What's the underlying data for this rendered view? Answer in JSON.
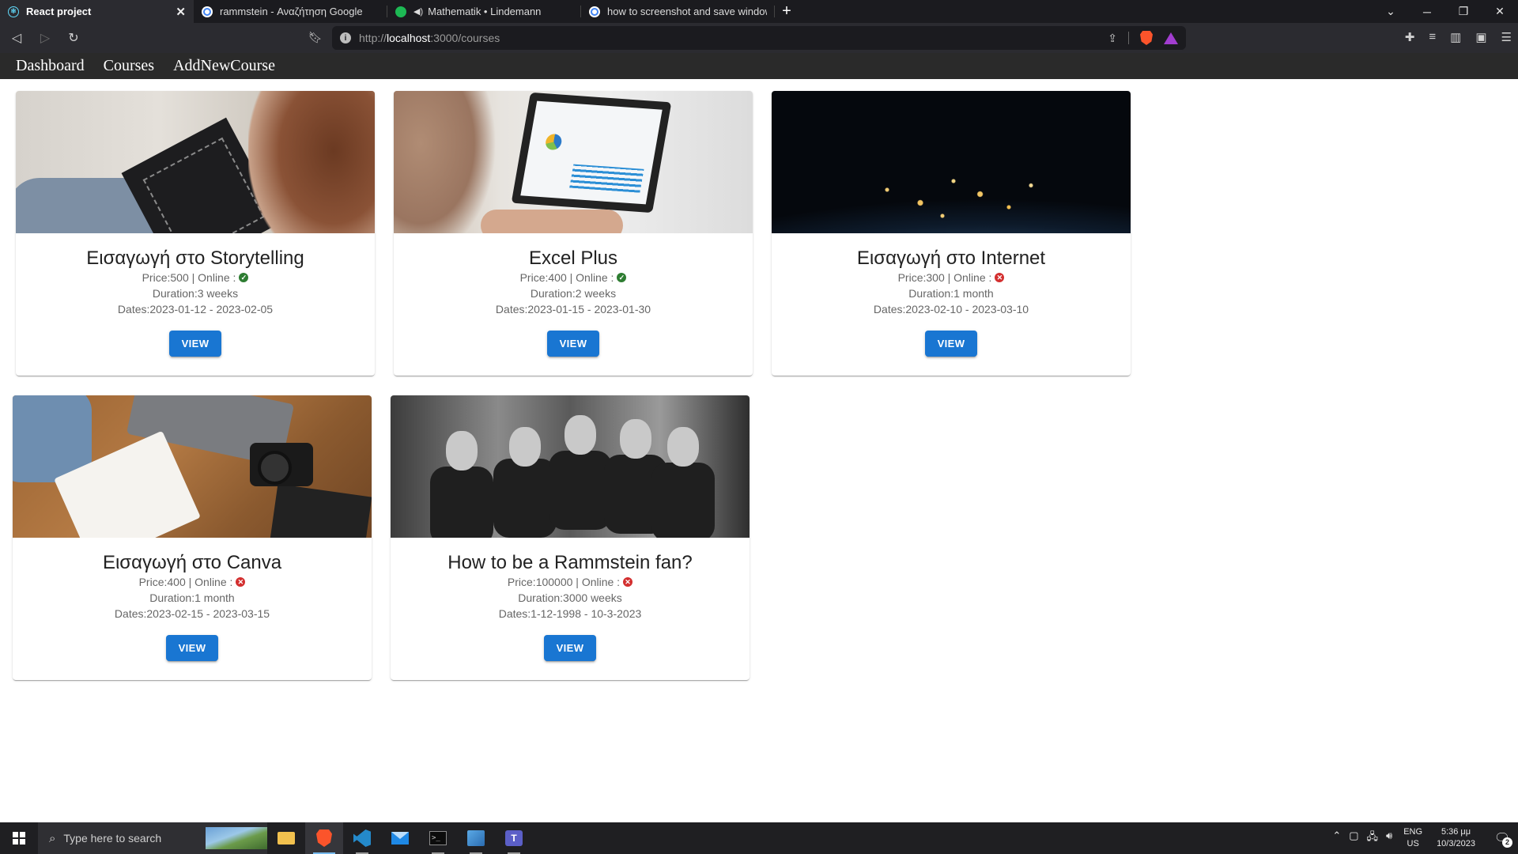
{
  "browser": {
    "tabs": [
      {
        "title": "React project",
        "favicon": "react-icon",
        "active": true
      },
      {
        "title": "rammstein - Αναζήτηση Google",
        "favicon": "google-icon",
        "active": false
      },
      {
        "title": "Mathematik • Lindemann",
        "favicon": "spotify-icon",
        "active": false,
        "audio": true
      },
      {
        "title": "how to screenshot and save windows",
        "favicon": "google-icon",
        "active": false
      }
    ],
    "url_prefix": "http://",
    "url_host": "localhost",
    "url_path": ":3000/courses"
  },
  "nav": {
    "links": [
      "Dashboard",
      "Courses",
      "AddNewCourse"
    ]
  },
  "courses": [
    {
      "title": "Εισαγωγή στο Storytelling",
      "price_text": "Price:500 | Online :",
      "online": true,
      "duration_text": "Duration:3 weeks",
      "dates_text": "Dates:2023-01-12 - 2023-02-05",
      "button": "VIEW",
      "image": "storytelling-photo"
    },
    {
      "title": "Excel Plus",
      "price_text": "Price:400 | Online :",
      "online": true,
      "duration_text": "Duration:2 weeks",
      "dates_text": "Dates:2023-01-15 - 2023-01-30",
      "button": "VIEW",
      "image": "laptop-analytics-photo"
    },
    {
      "title": "Εισαγωγή στο Internet",
      "price_text": "Price:300 | Online :",
      "online": false,
      "duration_text": "Duration:1 month",
      "dates_text": "Dates:2023-02-10 - 2023-03-10",
      "button": "VIEW",
      "image": "earth-at-night-photo"
    },
    {
      "title": "Εισαγωγή στο Canva",
      "price_text": "Price:400 | Online :",
      "online": false,
      "duration_text": "Duration:1 month",
      "dates_text": "Dates:2023-02-15 - 2023-03-15",
      "button": "VIEW",
      "image": "desk-sketch-photo"
    },
    {
      "title": "How to be a Rammstein fan?",
      "price_text": "Price:100000 | Online :",
      "online": false,
      "duration_text": "Duration:3000 weeks",
      "dates_text": "Dates:1-12-1998 - 10-3-2023",
      "button": "VIEW",
      "image": "band-photo"
    }
  ],
  "taskbar": {
    "search_placeholder": "Type here to search",
    "lang_top": "ENG",
    "lang_bottom": "US",
    "time": "5:36 μμ",
    "date": "10/3/2023",
    "notifications": "2"
  },
  "colors": {
    "primary": "#1976d2",
    "online_true": "#2e7d32",
    "online_false": "#d32f2f",
    "navbar_bg": "#2a2a2a"
  }
}
